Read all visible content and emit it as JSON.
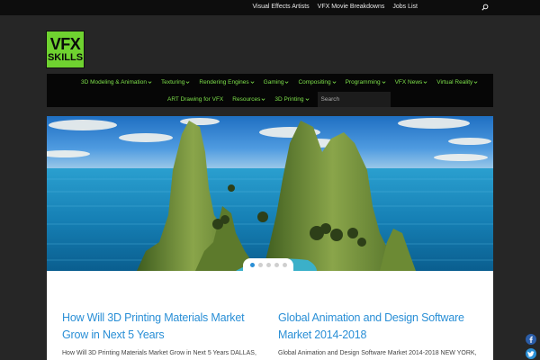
{
  "topbar": {
    "links": [
      "Visual Effects Artists",
      "VFX Movie Breakdowns",
      "Jobs List"
    ],
    "search_icon": "search-icon"
  },
  "logo": {
    "line1": "VFX",
    "line2": "SKILLS"
  },
  "nav": {
    "row1": [
      "3D Modeling & Animation",
      "Texturing",
      "Rendering Engines",
      "Gaming",
      "Compositing",
      "Programming",
      "VFX News",
      "Virtual Reality"
    ],
    "row2": [
      "ART Drawing for VFX",
      "Resources",
      "3D Printing"
    ],
    "search_placeholder": "Search",
    "chevron_icon": "chevron-down-icon"
  },
  "slider": {
    "dots": 5,
    "active_dot": 1
  },
  "posts": [
    {
      "title": "How Will 3D Printing Materials Market Grow in Next 5 Years",
      "excerpt": "How Will 3D Printing Materials Market Grow in Next 5 Years DALLAS,"
    },
    {
      "title": "Global Animation and Design Software Market 2014-2018",
      "excerpt": "Global Animation and Design Software Market 2014-2018 NEW YORK,"
    }
  ],
  "social": [
    "facebook-icon",
    "twitter-icon"
  ],
  "colors": {
    "accent_green": "#7de04a",
    "logo_green": "#6fd230",
    "link_blue": "#2a8fd6",
    "background": "#262626"
  }
}
